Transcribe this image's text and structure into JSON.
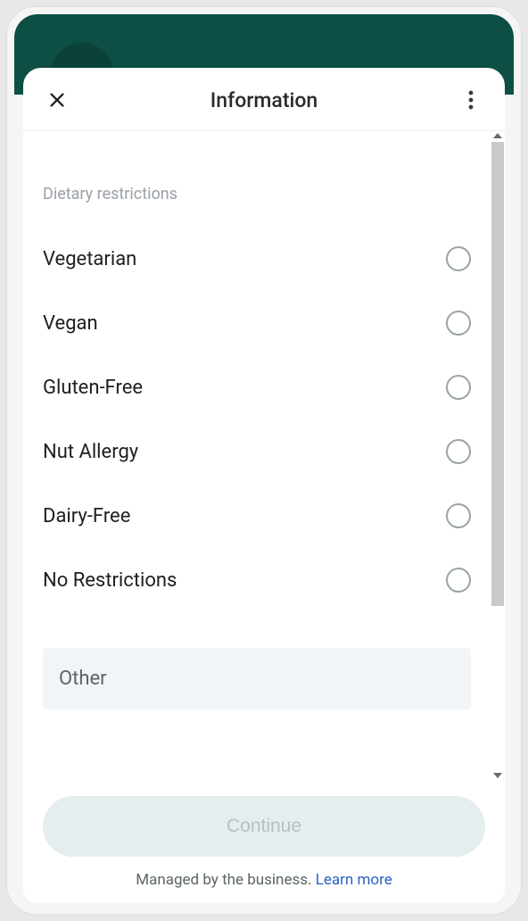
{
  "header": {
    "title": "Information"
  },
  "section": {
    "label": "Dietary restrictions",
    "options": [
      {
        "label": "Vegetarian"
      },
      {
        "label": "Vegan"
      },
      {
        "label": "Gluten-Free"
      },
      {
        "label": "Nut Allergy"
      },
      {
        "label": "Dairy-Free"
      },
      {
        "label": "No Restrictions"
      }
    ]
  },
  "other_input": {
    "placeholder": "Other"
  },
  "footer": {
    "continue_label": "Continue",
    "managed_text": "Managed by the business. ",
    "learn_more_label": "Learn more"
  }
}
